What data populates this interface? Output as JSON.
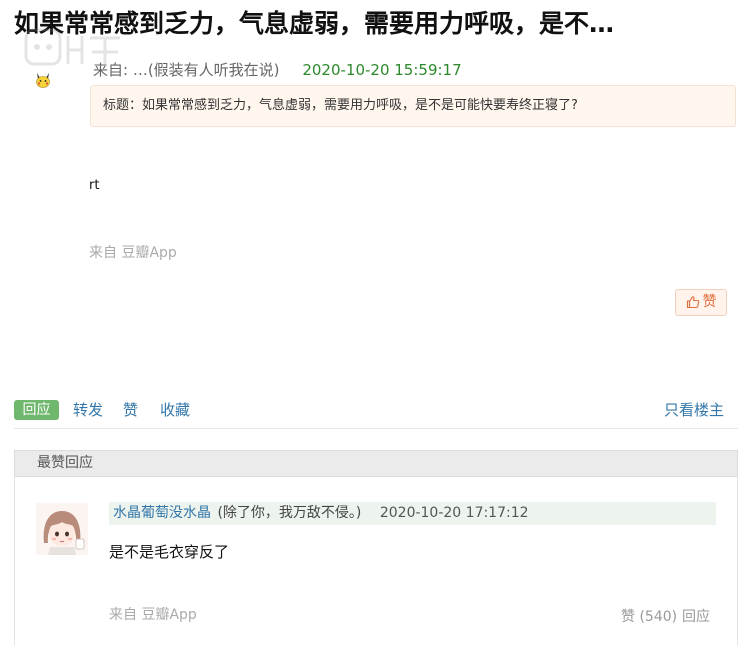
{
  "topic": {
    "title": "如果常常感到乏力，气息虚弱，需要用力呼吸，是不…",
    "author_from": "来自: …(假装有人听我在说)",
    "date": "2020-10-20 15:59:17",
    "subject_box": "标题：如果常常感到乏力，气息虚弱，需要用力呼吸，是不是可能快要寿终正寝了?",
    "body": "rt",
    "source": "来自 豆瓣App",
    "like_label": "赞"
  },
  "actions": {
    "reply": "回应",
    "forward": "转发",
    "like": "赞",
    "collect": "收藏",
    "only_op": "只看楼主"
  },
  "best_replies": {
    "header": "最赞回应",
    "items": [
      {
        "user": "水晶葡萄没水晶",
        "signature": "(除了你，我万敌不侵。)",
        "time": "2020-10-20 17:17:12",
        "text": "是不是毛衣穿反了",
        "source": "来自 豆瓣App",
        "like_label": "赞 (540)",
        "reply_label": "回应"
      }
    ]
  },
  "icons": {
    "watermark": "gamersky-watermark-logo",
    "author_avatar": "pikachu-avatar-icon",
    "like": "thumbs-up-icon",
    "reply_avatar": "anime-girl-avatar"
  },
  "colors": {
    "link": "#3377aa",
    "date_green": "#2c8a2c",
    "reply_button": "#6fb76d",
    "like_accent": "#e16e3d",
    "subject_bg": "#fff6ed"
  }
}
